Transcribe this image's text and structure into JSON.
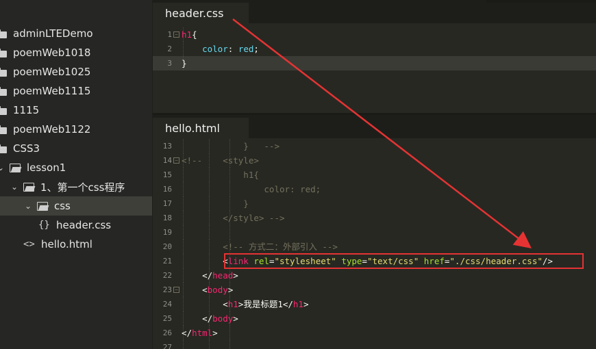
{
  "sidebar": {
    "items": [
      {
        "label": "adminLTEDemo",
        "kind": "folder-closed",
        "depth": 0
      },
      {
        "label": "poemWeb1018",
        "kind": "folder-closed",
        "depth": 0
      },
      {
        "label": "poemWeb1025",
        "kind": "folder-closed",
        "depth": 0
      },
      {
        "label": "poemWeb1115",
        "kind": "folder-closed",
        "depth": 0
      },
      {
        "label": "1115",
        "kind": "folder-closed",
        "depth": 0
      },
      {
        "label": "poemWeb1122",
        "kind": "folder-closed",
        "depth": 0
      },
      {
        "label": "CSS3",
        "kind": "folder-closed",
        "depth": 0
      },
      {
        "label": "lesson1",
        "kind": "folder-open",
        "depth": 0
      },
      {
        "label": "1、第一个css程序",
        "kind": "folder-open",
        "depth": 1
      },
      {
        "label": "css",
        "kind": "folder-open",
        "depth": 2,
        "selected": true
      },
      {
        "label": "header.css",
        "kind": "file-css",
        "depth": 3,
        "glyph": "{}"
      },
      {
        "label": "hello.html",
        "kind": "file-html",
        "depth": 2,
        "glyph": "<>"
      }
    ]
  },
  "top_pane": {
    "tab_label": "header.css",
    "lines": [
      {
        "num": "1",
        "fold": "⊟",
        "tokens": [
          [
            "tag",
            "h1"
          ],
          [
            "plain",
            "{"
          ]
        ]
      },
      {
        "num": "2",
        "fold": "",
        "tokens": [
          [
            "plain",
            "    "
          ],
          [
            "val",
            "color"
          ],
          [
            "plain",
            ": "
          ],
          [
            "val",
            "red"
          ],
          [
            "plain",
            ";"
          ]
        ]
      },
      {
        "num": "3",
        "fold": "",
        "tokens": [
          [
            "plain",
            "}"
          ]
        ],
        "active": true
      }
    ]
  },
  "bottom_pane": {
    "tab_label": "hello.html",
    "lines": [
      {
        "num": "13",
        "fold": "",
        "tokens": [
          [
            "cmt",
            "            }   -->"
          ]
        ]
      },
      {
        "num": "14",
        "fold": "⊟",
        "tokens": [
          [
            "cmt",
            "<!--    <style>"
          ]
        ]
      },
      {
        "num": "15",
        "fold": "",
        "tokens": [
          [
            "cmt",
            "            h1{"
          ]
        ]
      },
      {
        "num": "16",
        "fold": "",
        "tokens": [
          [
            "cmt",
            "                color: red;"
          ]
        ]
      },
      {
        "num": "17",
        "fold": "",
        "tokens": [
          [
            "cmt",
            "            }"
          ]
        ]
      },
      {
        "num": "18",
        "fold": "",
        "tokens": [
          [
            "cmt",
            "        </style> -->"
          ]
        ]
      },
      {
        "num": "19",
        "fold": "",
        "tokens": []
      },
      {
        "num": "20",
        "fold": "",
        "tokens": [
          [
            "cmt",
            "        <!-- 方式二：外部引入 -->"
          ]
        ]
      },
      {
        "num": "21",
        "fold": "",
        "tokens": [
          [
            "plain",
            "        <"
          ],
          [
            "tag",
            "link"
          ],
          [
            "plain",
            " "
          ],
          [
            "attr",
            "rel"
          ],
          [
            "plain",
            "="
          ],
          [
            "str",
            "\"stylesheet\""
          ],
          [
            "plain",
            " "
          ],
          [
            "attr",
            "type"
          ],
          [
            "plain",
            "="
          ],
          [
            "str",
            "\"text/css\""
          ],
          [
            "plain",
            " "
          ],
          [
            "attr",
            "href"
          ],
          [
            "plain",
            "="
          ],
          [
            "str",
            "\"./css/header.css\""
          ],
          [
            "plain",
            "/>"
          ]
        ]
      },
      {
        "num": "22",
        "fold": "",
        "tokens": [
          [
            "plain",
            "    </"
          ],
          [
            "tag",
            "head"
          ],
          [
            "plain",
            ">"
          ]
        ]
      },
      {
        "num": "23",
        "fold": "⊟",
        "tokens": [
          [
            "plain",
            "    <"
          ],
          [
            "tag",
            "body"
          ],
          [
            "plain",
            ">"
          ]
        ]
      },
      {
        "num": "24",
        "fold": "",
        "tokens": [
          [
            "plain",
            "        <"
          ],
          [
            "tag",
            "h1"
          ],
          [
            "plain",
            ">我是标题1</"
          ],
          [
            "tag",
            "h1"
          ],
          [
            "plain",
            ">"
          ]
        ]
      },
      {
        "num": "25",
        "fold": "",
        "tokens": [
          [
            "plain",
            "    </"
          ],
          [
            "tag",
            "body"
          ],
          [
            "plain",
            ">"
          ]
        ]
      },
      {
        "num": "26",
        "fold": "",
        "tokens": [
          [
            "plain",
            "</"
          ],
          [
            "tag",
            "html"
          ],
          [
            "plain",
            ">"
          ]
        ]
      },
      {
        "num": "27",
        "fold": "",
        "tokens": []
      }
    ]
  },
  "annotation": {
    "box_color": "#e53333",
    "arrow_color": "#e53333"
  },
  "colors": {
    "tag": "#f92672",
    "attribute": "#a6e22e",
    "string": "#e6db74",
    "comment": "#75715e",
    "background": "#272822"
  }
}
